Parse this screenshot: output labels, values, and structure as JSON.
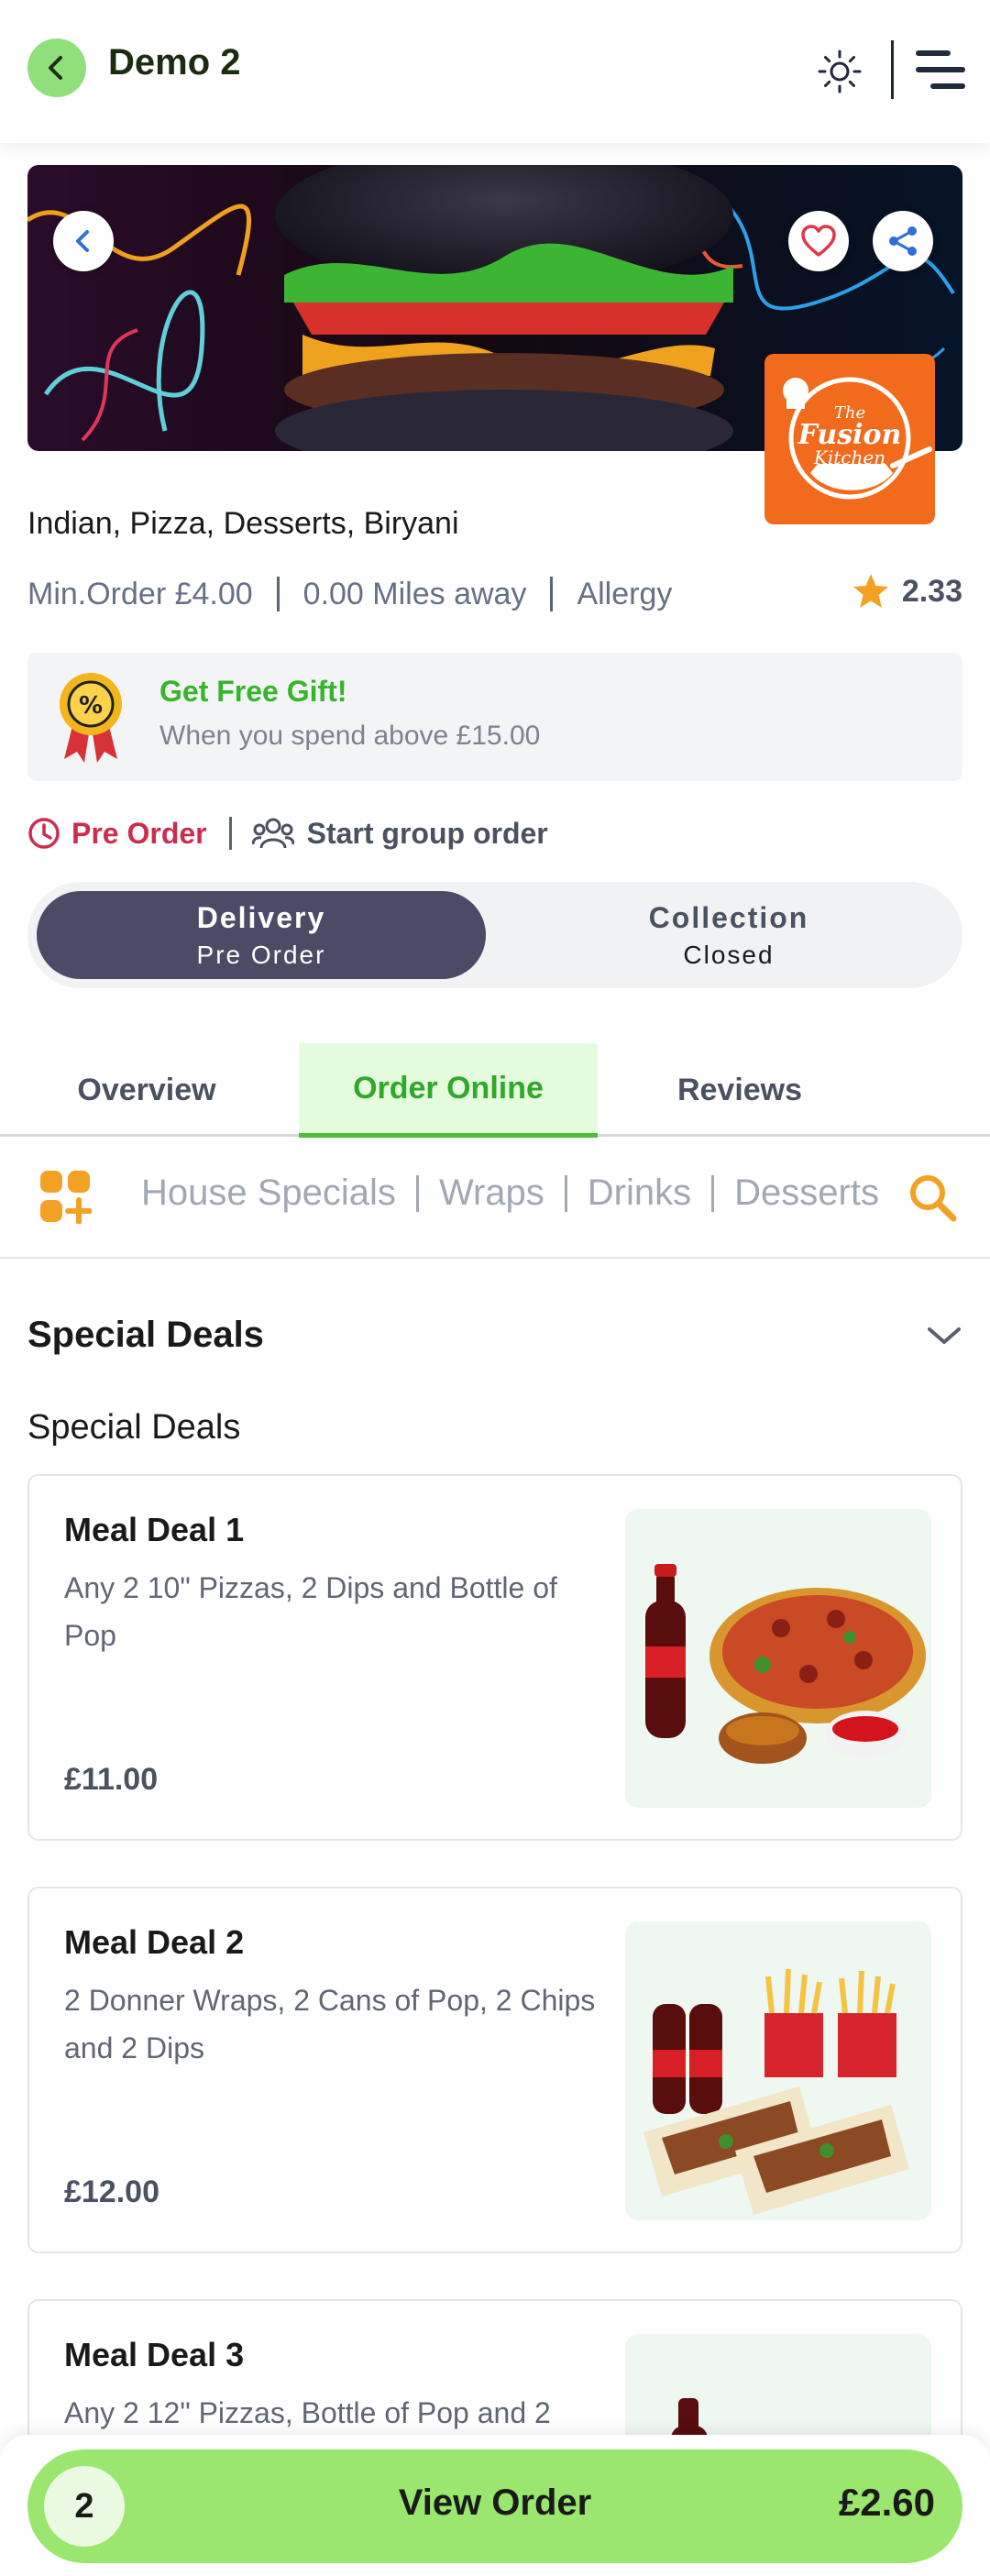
{
  "header": {
    "title": "Demo 2"
  },
  "restaurant": {
    "logo_line1": "The",
    "logo_line2": "Fusion",
    "logo_line3": "Kitchen",
    "cuisines": "Indian, Pizza, Desserts, Biryani",
    "min_order": "Min.Order £4.00",
    "distance": "0.00 Miles away",
    "allergy": "Allergy",
    "rating": "2.33"
  },
  "offer": {
    "title": "Get Free Gift!",
    "subtitle": "When you spend above £15.00",
    "badge_symbol": "%"
  },
  "order_options": {
    "pre_order": "Pre Order",
    "group_order": "Start group order"
  },
  "mode_toggle": {
    "delivery_label": "Delivery",
    "delivery_status": "Pre Order",
    "collection_label": "Collection",
    "collection_status": "Closed"
  },
  "tabs": [
    {
      "label": "Overview"
    },
    {
      "label": "Order Online"
    },
    {
      "label": "Reviews"
    }
  ],
  "categories": [
    "House Specials",
    "Wraps",
    "Drinks",
    "Desserts"
  ],
  "section": {
    "title": "Special Deals",
    "subtitle": "Special Deals"
  },
  "items": [
    {
      "name": "Meal Deal 1",
      "description": "Any 2 10\" Pizzas, 2 Dips and Bottle of Pop",
      "price": "£11.00"
    },
    {
      "name": "Meal Deal 2",
      "description": "2 Donner Wraps, 2 Cans of Pop, 2 Chips and 2 Dips",
      "price": "£12.00"
    },
    {
      "name": "Meal Deal 3",
      "description": "Any 2 12\" Pizzas, Bottle of Pop and 2",
      "price": ""
    }
  ],
  "order_bar": {
    "quantity": "2",
    "label": "View Order",
    "total": "£2.60"
  },
  "colors": {
    "accent_green": "#4ebd3b",
    "button_green": "#9be66f",
    "toggle_dark": "#4c4b66",
    "pre_order_red": "#cc2d4f",
    "category_orange": "#f2a125",
    "logo_orange": "#f26b1d"
  }
}
